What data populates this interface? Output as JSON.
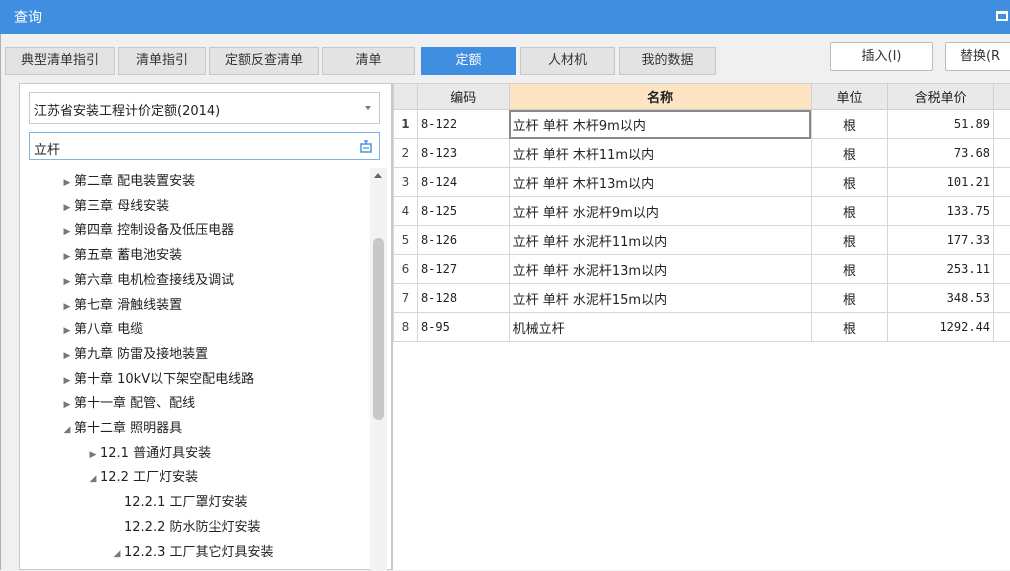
{
  "window": {
    "title": "查询"
  },
  "tabs": [
    {
      "label": "典型清单指引"
    },
    {
      "label": "清单指引"
    },
    {
      "label": "定额反查清单"
    },
    {
      "label": "清单"
    },
    {
      "label": "定额"
    },
    {
      "label": "人材机"
    },
    {
      "label": "我的数据"
    }
  ],
  "active_tab": "定额",
  "toolbar": {
    "insert_label": "插入(I)",
    "replace_label": "替换(R"
  },
  "left": {
    "quota_library": "江苏省安装工程计价定额(2014)",
    "search_value": "立杆",
    "tree": [
      {
        "label": "第二章 配电装置安装",
        "state": "collapsed",
        "level": 0
      },
      {
        "label": "第三章 母线安装",
        "state": "collapsed",
        "level": 0
      },
      {
        "label": "第四章 控制设备及低压电器",
        "state": "collapsed",
        "level": 0
      },
      {
        "label": "第五章 蓄电池安装",
        "state": "collapsed",
        "level": 0
      },
      {
        "label": "第六章 电机检查接线及调试",
        "state": "collapsed",
        "level": 0
      },
      {
        "label": "第七章 滑触线装置",
        "state": "collapsed",
        "level": 0
      },
      {
        "label": "第八章 电缆",
        "state": "collapsed",
        "level": 0
      },
      {
        "label": "第九章 防雷及接地装置",
        "state": "collapsed",
        "level": 0
      },
      {
        "label": "第十章 10kV以下架空配电线路",
        "state": "collapsed",
        "level": 0
      },
      {
        "label": "第十一章 配管、配线",
        "state": "collapsed",
        "level": 0
      },
      {
        "label": "第十二章 照明器具",
        "state": "expanded",
        "level": 0
      },
      {
        "label": "12.1 普通灯具安装",
        "state": "collapsed",
        "level": 1
      },
      {
        "label": "12.2 工厂灯安装",
        "state": "expanded",
        "level": 1
      },
      {
        "label": "12.2.1 工厂罩灯安装",
        "state": "leaf",
        "level": 2
      },
      {
        "label": "12.2.2 防水防尘灯安装",
        "state": "leaf",
        "level": 2
      },
      {
        "label": "12.2.3 工厂其它灯具安装",
        "state": "expanded",
        "level": 2
      }
    ]
  },
  "table": {
    "columns": [
      "",
      "编码",
      "名称",
      "单位",
      "含税单价"
    ],
    "rows": [
      {
        "idx": "1",
        "code": "8-122",
        "name": "立杆 单杆 木杆9m以内",
        "unit": "根",
        "price": "51.89"
      },
      {
        "idx": "2",
        "code": "8-123",
        "name": "立杆 单杆 木杆11m以内",
        "unit": "根",
        "price": "73.68"
      },
      {
        "idx": "3",
        "code": "8-124",
        "name": "立杆 单杆 木杆13m以内",
        "unit": "根",
        "price": "101.21"
      },
      {
        "idx": "4",
        "code": "8-125",
        "name": "立杆 单杆 水泥杆9m以内",
        "unit": "根",
        "price": "133.75"
      },
      {
        "idx": "5",
        "code": "8-126",
        "name": "立杆 单杆 水泥杆11m以内",
        "unit": "根",
        "price": "177.33"
      },
      {
        "idx": "6",
        "code": "8-127",
        "name": "立杆 单杆 水泥杆13m以内",
        "unit": "根",
        "price": "253.11"
      },
      {
        "idx": "7",
        "code": "8-128",
        "name": "立杆 单杆 水泥杆15m以内",
        "unit": "根",
        "price": "348.53"
      },
      {
        "idx": "8",
        "code": "8-95",
        "name": "机械立杆",
        "unit": "根",
        "price": "1292.44"
      }
    ]
  },
  "colors": {
    "accent": "#3f8ee0",
    "header_sorted": "#fde5c4"
  }
}
